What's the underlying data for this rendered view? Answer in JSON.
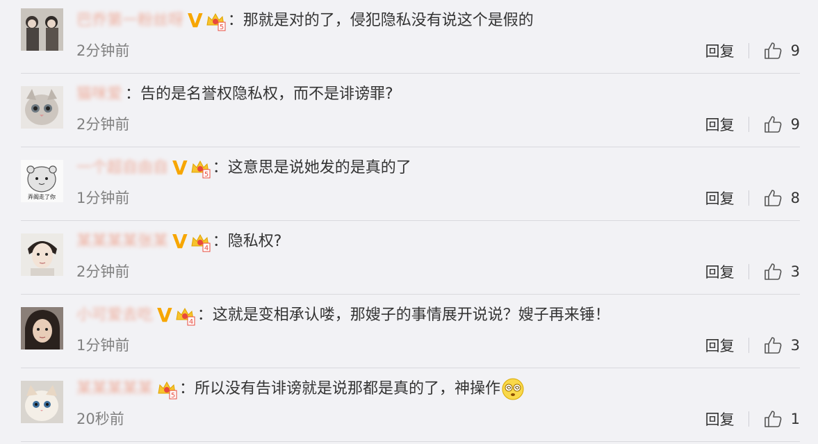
{
  "comments": [
    {
      "username": "巴乔第一粉丝呀",
      "has_v": true,
      "crown_level": "5",
      "colon": "：",
      "text": "那就是对的了，侵犯隐私没有说这个是假的",
      "time": "2分钟前",
      "reply_label": "回复",
      "likes": "9",
      "avatar": "two-men-avatar"
    },
    {
      "username": "猫咪爱",
      "has_v": false,
      "crown_level": "",
      "colon": "：",
      "text": "告的是名誉权隐私权，而不是诽谤罪?",
      "time": "2分钟前",
      "reply_label": "回复",
      "likes": "9",
      "avatar": "cat-avatar"
    },
    {
      "username": "一个超自由自",
      "has_v": true,
      "crown_level": "5",
      "colon": "：",
      "text": "这意思是说她发的是真的了",
      "time": "1分钟前",
      "reply_label": "回复",
      "likes": "8",
      "avatar": "hamster-avatar",
      "avatar_caption": "弄阁走了你"
    },
    {
      "username": "某某某某张某",
      "has_v": true,
      "crown_level": "4",
      "colon": "：",
      "text": "隐私权?",
      "time": "2分钟前",
      "reply_label": "回复",
      "likes": "3",
      "avatar": "illustrated-boy-avatar"
    },
    {
      "username": "小可爱去吃",
      "has_v": true,
      "crown_level": "4",
      "colon": "：",
      "text": "这就是变相承认喽，那嫂子的事情展开说说？嫂子再来锤！",
      "time": "1分钟前",
      "reply_label": "回复",
      "likes": "3",
      "avatar": "girl-avatar"
    },
    {
      "username": "某某某某某",
      "has_v": false,
      "crown_level": "5",
      "colon": "：",
      "text": "所以没有告诽谤就是说那都是真的了，神操作",
      "time": "20秒前",
      "reply_label": "回复",
      "likes": "1",
      "avatar": "kitten-avatar",
      "emoji": "dizzy-face-emoji"
    }
  ],
  "colors": {
    "background": "#f2f2f5",
    "username": "#eb7350",
    "verified": "#f7a600",
    "crown": "#f7c32e",
    "time": "#808080"
  }
}
